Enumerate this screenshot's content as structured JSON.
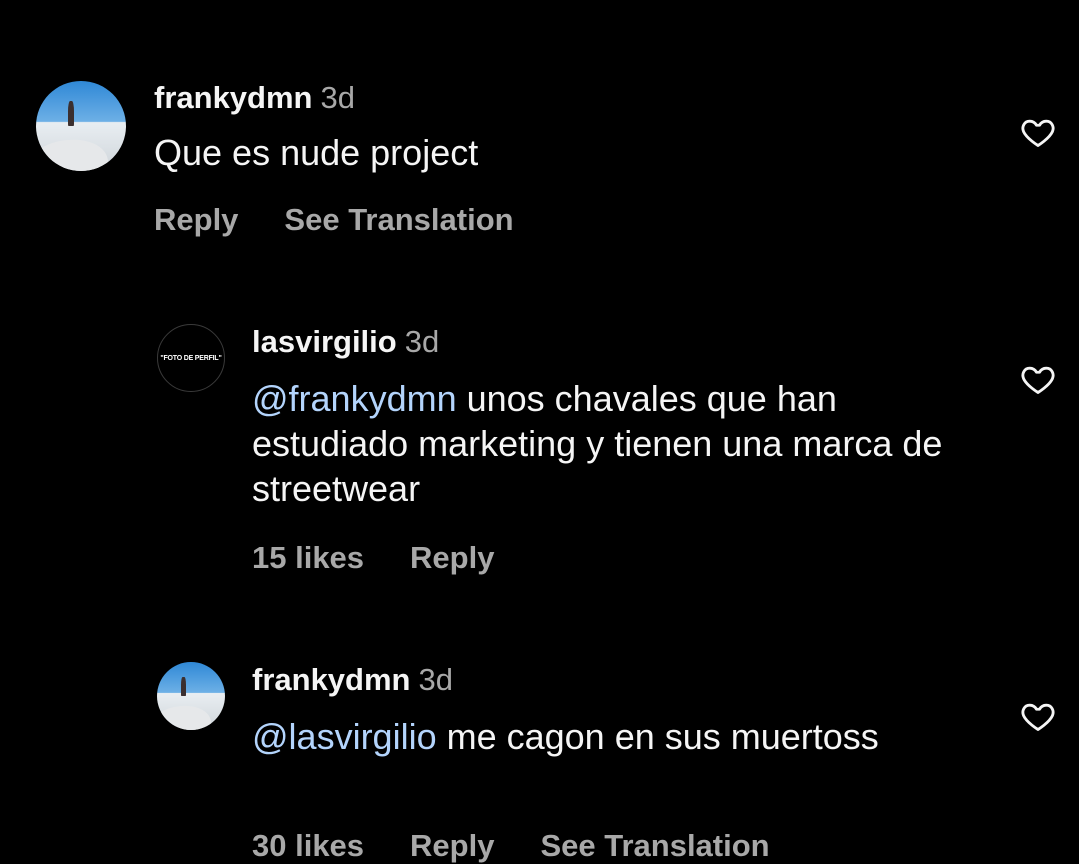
{
  "comments": [
    {
      "username": "frankydmn",
      "time": "3d",
      "avatar_icon": "profile-photo",
      "text_mention": "",
      "text": "Que es nude project",
      "actions": [
        "Reply",
        "See Translation"
      ]
    },
    {
      "username": "lasvirgilio",
      "time": "3d",
      "avatar_icon": "profile-placeholder",
      "avatar_text": "\"FOTO DE PERFIL\"",
      "text_mention": "@frankydmn",
      "text": " unos chavales que han estudiado marketing y tienen una marca de streetwear",
      "actions": [
        "15 likes",
        "Reply"
      ]
    },
    {
      "username": "frankydmn",
      "time": "3d",
      "avatar_icon": "profile-photo",
      "text_mention": "@lasvirgilio",
      "text": " me cagon en sus muertoss",
      "actions": [
        "30 likes",
        "Reply",
        "See Translation"
      ]
    }
  ],
  "icons": {
    "like": "heart-outline-icon"
  },
  "colors": {
    "background": "#000000",
    "text": "#f5f5f5",
    "muted": "#a8a8a8",
    "mention": "#b3d4fc"
  }
}
